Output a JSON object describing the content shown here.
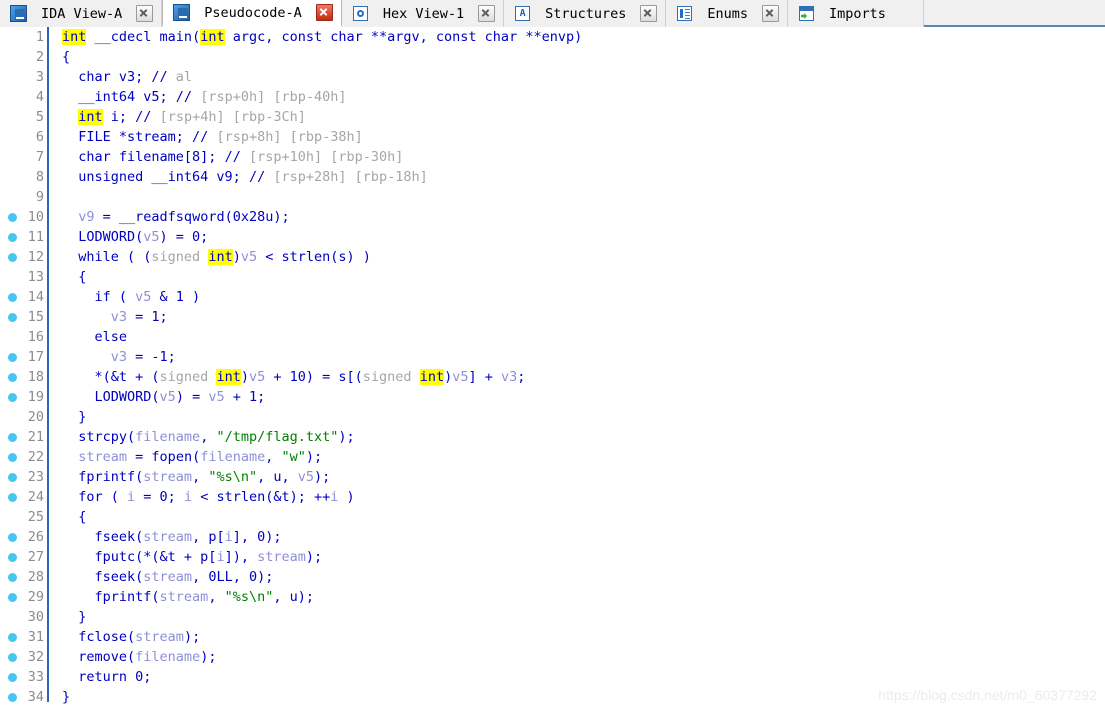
{
  "window": {
    "title": "IDA Pseudocode-A",
    "watermark": "https://blog.csdn.net/m0_60377292"
  },
  "tabs": [
    {
      "label": "IDA View-A",
      "icon": "document-icon",
      "icon_kind": "doc",
      "active": false,
      "closable": true,
      "close_style": "grey"
    },
    {
      "label": "Pseudocode-A",
      "icon": "document-icon",
      "icon_kind": "doc",
      "active": true,
      "closable": true,
      "close_style": "red"
    },
    {
      "label": "Hex View-1",
      "icon": "hex-view-icon",
      "icon_kind": "hex",
      "active": false,
      "closable": true,
      "close_style": "grey"
    },
    {
      "label": "Structures",
      "icon": "structures-icon",
      "icon_kind": "struct",
      "active": false,
      "closable": true,
      "close_style": "grey"
    },
    {
      "label": "Enums",
      "icon": "enums-icon",
      "icon_kind": "enum",
      "active": false,
      "closable": true,
      "close_style": "grey"
    },
    {
      "label": "Imports",
      "icon": "imports-icon",
      "icon_kind": "import",
      "active": false,
      "closable": false,
      "close_style": "grey"
    }
  ],
  "colors": {
    "keyword": "#0000c0",
    "keyword_highlight_bg": "#ffff00",
    "local_var": "#8f8fd8",
    "string": "#008000",
    "comment_dim": "#a6a6a6",
    "gutter_number": "#8c8c8c",
    "breakpoint_dot": "#47c6f2",
    "gutter_rule": "#2c64b8",
    "tabbar_bg": "#f0f0f0",
    "tabbar_underline": "#5b87ad",
    "active_tab_bg": "#ffffff",
    "code_bg": "#ffffff",
    "watermark": "#ececec"
  },
  "code": {
    "first_line": 1,
    "last_line": 34,
    "lines": [
      {
        "n": 1,
        "bp": false,
        "tokens": [
          {
            "t": "int",
            "c": "kwhl"
          },
          {
            "t": " __cdecl ",
            "c": "plain"
          },
          {
            "t": "main",
            "c": "plain"
          },
          {
            "t": "(",
            "c": "plain"
          },
          {
            "t": "int",
            "c": "kwhl"
          },
          {
            "t": " argc, const char **argv, const char **envp)",
            "c": "plain"
          }
        ]
      },
      {
        "n": 2,
        "bp": false,
        "tokens": [
          {
            "t": "{",
            "c": "plain"
          }
        ]
      },
      {
        "n": 3,
        "bp": false,
        "tokens": [
          {
            "t": "  char v3; ",
            "c": "plain"
          },
          {
            "t": "// ",
            "c": "plain"
          },
          {
            "t": "al",
            "c": "dim"
          }
        ]
      },
      {
        "n": 4,
        "bp": false,
        "tokens": [
          {
            "t": "  __int64 v5; ",
            "c": "plain"
          },
          {
            "t": "// ",
            "c": "plain"
          },
          {
            "t": "[rsp+0h] [rbp-40h]",
            "c": "dim"
          }
        ]
      },
      {
        "n": 5,
        "bp": false,
        "tokens": [
          {
            "t": "  ",
            "c": "plain"
          },
          {
            "t": "int",
            "c": "kwhl"
          },
          {
            "t": " i; ",
            "c": "plain"
          },
          {
            "t": "// ",
            "c": "plain"
          },
          {
            "t": "[rsp+4h] [rbp-3Ch]",
            "c": "dim"
          }
        ]
      },
      {
        "n": 6,
        "bp": false,
        "tokens": [
          {
            "t": "  FILE *stream; ",
            "c": "plain"
          },
          {
            "t": "// ",
            "c": "plain"
          },
          {
            "t": "[rsp+8h] [rbp-38h]",
            "c": "dim"
          }
        ]
      },
      {
        "n": 7,
        "bp": false,
        "tokens": [
          {
            "t": "  char filename[8]; ",
            "c": "plain"
          },
          {
            "t": "// ",
            "c": "plain"
          },
          {
            "t": "[rsp+10h] [rbp-30h]",
            "c": "dim"
          }
        ]
      },
      {
        "n": 8,
        "bp": false,
        "tokens": [
          {
            "t": "  unsigned __int64 v9; ",
            "c": "plain"
          },
          {
            "t": "// ",
            "c": "plain"
          },
          {
            "t": "[rsp+28h] [rbp-18h]",
            "c": "dim"
          }
        ]
      },
      {
        "n": 9,
        "bp": false,
        "tokens": [
          {
            "t": "",
            "c": "plain"
          }
        ]
      },
      {
        "n": 10,
        "bp": true,
        "tokens": [
          {
            "t": "  ",
            "c": "plain"
          },
          {
            "t": "v9",
            "c": "lvar"
          },
          {
            "t": " = __readfsqword(0x28u);",
            "c": "plain"
          }
        ]
      },
      {
        "n": 11,
        "bp": true,
        "tokens": [
          {
            "t": "  LODWORD(",
            "c": "plain"
          },
          {
            "t": "v5",
            "c": "lvar"
          },
          {
            "t": ") = 0;",
            "c": "plain"
          }
        ]
      },
      {
        "n": 12,
        "bp": true,
        "tokens": [
          {
            "t": "  while ( (",
            "c": "plain"
          },
          {
            "t": "signed ",
            "c": "dim"
          },
          {
            "t": "int",
            "c": "kwhl"
          },
          {
            "t": ")",
            "c": "plain"
          },
          {
            "t": "v5",
            "c": "lvar"
          },
          {
            "t": " < strlen(",
            "c": "plain"
          },
          {
            "t": "s",
            "c": "plain"
          },
          {
            "t": ") )",
            "c": "plain"
          }
        ]
      },
      {
        "n": 13,
        "bp": false,
        "tokens": [
          {
            "t": "  {",
            "c": "plain"
          }
        ]
      },
      {
        "n": 14,
        "bp": true,
        "tokens": [
          {
            "t": "    if ( ",
            "c": "plain"
          },
          {
            "t": "v5",
            "c": "lvar"
          },
          {
            "t": " & 1 )",
            "c": "plain"
          }
        ]
      },
      {
        "n": 15,
        "bp": true,
        "tokens": [
          {
            "t": "      ",
            "c": "plain"
          },
          {
            "t": "v3",
            "c": "lvar"
          },
          {
            "t": " = 1;",
            "c": "plain"
          }
        ]
      },
      {
        "n": 16,
        "bp": false,
        "tokens": [
          {
            "t": "    else",
            "c": "plain"
          }
        ]
      },
      {
        "n": 17,
        "bp": true,
        "tokens": [
          {
            "t": "      ",
            "c": "plain"
          },
          {
            "t": "v3",
            "c": "lvar"
          },
          {
            "t": " = -1;",
            "c": "plain"
          }
        ]
      },
      {
        "n": 18,
        "bp": true,
        "tokens": [
          {
            "t": "    *(&t + (",
            "c": "plain"
          },
          {
            "t": "signed ",
            "c": "dim"
          },
          {
            "t": "int",
            "c": "kwhl"
          },
          {
            "t": ")",
            "c": "plain"
          },
          {
            "t": "v5",
            "c": "lvar"
          },
          {
            "t": " + 10) = s[(",
            "c": "plain"
          },
          {
            "t": "signed ",
            "c": "dim"
          },
          {
            "t": "int",
            "c": "kwhl"
          },
          {
            "t": ")",
            "c": "plain"
          },
          {
            "t": "v5",
            "c": "lvar"
          },
          {
            "t": "] + ",
            "c": "plain"
          },
          {
            "t": "v3",
            "c": "lvar"
          },
          {
            "t": ";",
            "c": "plain"
          }
        ]
      },
      {
        "n": 19,
        "bp": true,
        "tokens": [
          {
            "t": "    LODWORD(",
            "c": "plain"
          },
          {
            "t": "v5",
            "c": "lvar"
          },
          {
            "t": ") = ",
            "c": "plain"
          },
          {
            "t": "v5",
            "c": "lvar"
          },
          {
            "t": " + 1;",
            "c": "plain"
          }
        ]
      },
      {
        "n": 20,
        "bp": false,
        "tokens": [
          {
            "t": "  }",
            "c": "plain"
          }
        ]
      },
      {
        "n": 21,
        "bp": true,
        "tokens": [
          {
            "t": "  strcpy(",
            "c": "plain"
          },
          {
            "t": "filename",
            "c": "lvar"
          },
          {
            "t": ", ",
            "c": "plain"
          },
          {
            "t": "\"/tmp/flag.txt\"",
            "c": "str"
          },
          {
            "t": ");",
            "c": "plain"
          }
        ]
      },
      {
        "n": 22,
        "bp": true,
        "tokens": [
          {
            "t": "  ",
            "c": "plain"
          },
          {
            "t": "stream",
            "c": "lvar"
          },
          {
            "t": " = fopen(",
            "c": "plain"
          },
          {
            "t": "filename",
            "c": "lvar"
          },
          {
            "t": ", ",
            "c": "plain"
          },
          {
            "t": "\"w\"",
            "c": "str"
          },
          {
            "t": ");",
            "c": "plain"
          }
        ]
      },
      {
        "n": 23,
        "bp": true,
        "tokens": [
          {
            "t": "  fprintf(",
            "c": "plain"
          },
          {
            "t": "stream",
            "c": "lvar"
          },
          {
            "t": ", ",
            "c": "plain"
          },
          {
            "t": "\"%s\\n\"",
            "c": "str"
          },
          {
            "t": ", u, ",
            "c": "plain"
          },
          {
            "t": "v5",
            "c": "lvar"
          },
          {
            "t": ");",
            "c": "plain"
          }
        ]
      },
      {
        "n": 24,
        "bp": true,
        "tokens": [
          {
            "t": "  for ( ",
            "c": "plain"
          },
          {
            "t": "i",
            "c": "lvar"
          },
          {
            "t": " = 0; ",
            "c": "plain"
          },
          {
            "t": "i",
            "c": "lvar"
          },
          {
            "t": " < strlen(&t); ++",
            "c": "plain"
          },
          {
            "t": "i",
            "c": "lvar"
          },
          {
            "t": " )",
            "c": "plain"
          }
        ]
      },
      {
        "n": 25,
        "bp": false,
        "tokens": [
          {
            "t": "  {",
            "c": "plain"
          }
        ]
      },
      {
        "n": 26,
        "bp": true,
        "tokens": [
          {
            "t": "    fseek(",
            "c": "plain"
          },
          {
            "t": "stream",
            "c": "lvar"
          },
          {
            "t": ", p[",
            "c": "plain"
          },
          {
            "t": "i",
            "c": "lvar"
          },
          {
            "t": "], 0);",
            "c": "plain"
          }
        ]
      },
      {
        "n": 27,
        "bp": true,
        "tokens": [
          {
            "t": "    fputc(*(&t + p[",
            "c": "plain"
          },
          {
            "t": "i",
            "c": "lvar"
          },
          {
            "t": "]), ",
            "c": "plain"
          },
          {
            "t": "stream",
            "c": "lvar"
          },
          {
            "t": ");",
            "c": "plain"
          }
        ]
      },
      {
        "n": 28,
        "bp": true,
        "tokens": [
          {
            "t": "    fseek(",
            "c": "plain"
          },
          {
            "t": "stream",
            "c": "lvar"
          },
          {
            "t": ", 0LL, 0);",
            "c": "plain"
          }
        ]
      },
      {
        "n": 29,
        "bp": true,
        "tokens": [
          {
            "t": "    fprintf(",
            "c": "plain"
          },
          {
            "t": "stream",
            "c": "lvar"
          },
          {
            "t": ", ",
            "c": "plain"
          },
          {
            "t": "\"%s\\n\"",
            "c": "str"
          },
          {
            "t": ", u);",
            "c": "plain"
          }
        ]
      },
      {
        "n": 30,
        "bp": false,
        "tokens": [
          {
            "t": "  }",
            "c": "plain"
          }
        ]
      },
      {
        "n": 31,
        "bp": true,
        "tokens": [
          {
            "t": "  fclose(",
            "c": "plain"
          },
          {
            "t": "stream",
            "c": "lvar"
          },
          {
            "t": ");",
            "c": "plain"
          }
        ]
      },
      {
        "n": 32,
        "bp": true,
        "tokens": [
          {
            "t": "  remove(",
            "c": "plain"
          },
          {
            "t": "filename",
            "c": "lvar"
          },
          {
            "t": ");",
            "c": "plain"
          }
        ]
      },
      {
        "n": 33,
        "bp": true,
        "tokens": [
          {
            "t": "  return 0;",
            "c": "plain"
          }
        ]
      },
      {
        "n": 34,
        "bp": true,
        "tokens": [
          {
            "t": "}",
            "c": "plain"
          }
        ]
      }
    ]
  }
}
